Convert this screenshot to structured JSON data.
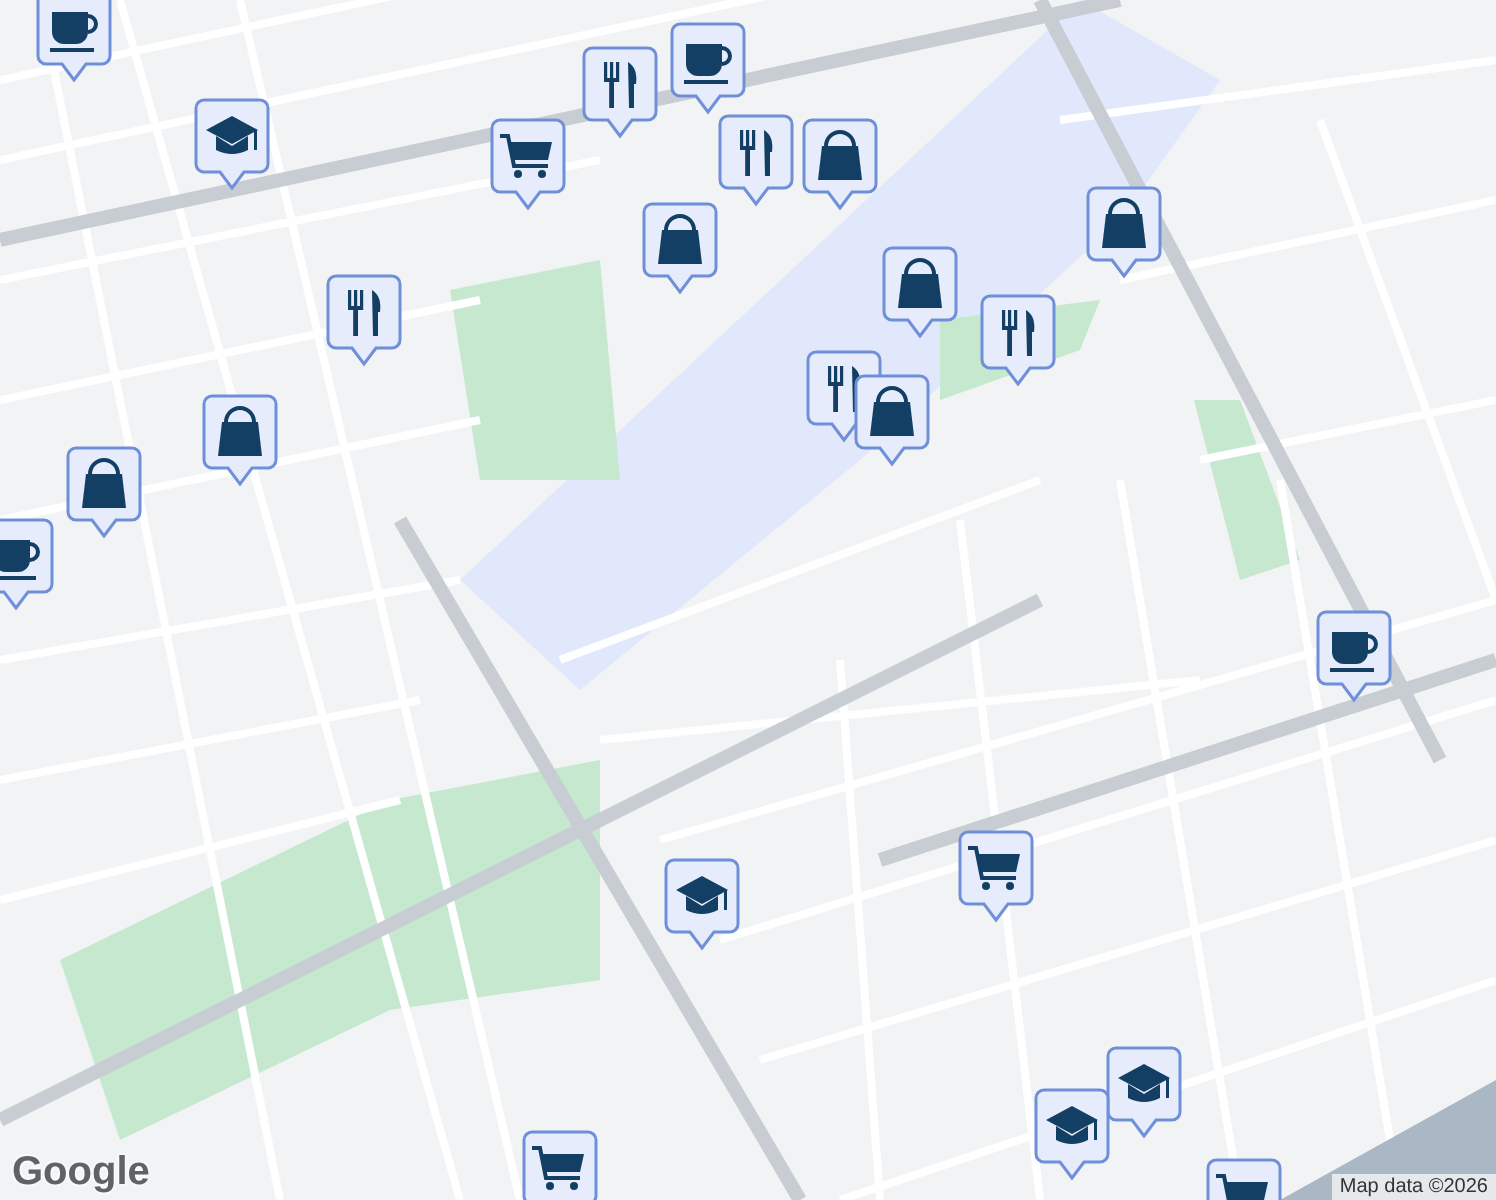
{
  "map": {
    "markers": [
      {
        "kind": "cafe"
      },
      {
        "kind": "school"
      },
      {
        "kind": "restaurant"
      },
      {
        "kind": "cafe"
      },
      {
        "kind": "cart"
      },
      {
        "kind": "restaurant"
      },
      {
        "kind": "bag"
      },
      {
        "kind": "bag"
      },
      {
        "kind": "bag"
      },
      {
        "kind": "restaurant"
      },
      {
        "kind": "bag"
      },
      {
        "kind": "restaurant"
      },
      {
        "kind": "restaurant"
      },
      {
        "kind": "bag"
      },
      {
        "kind": "bag"
      },
      {
        "kind": "bag"
      },
      {
        "kind": "cafe"
      },
      {
        "kind": "cafe"
      },
      {
        "kind": "cart"
      },
      {
        "kind": "school"
      },
      {
        "kind": "school"
      },
      {
        "kind": "school"
      },
      {
        "kind": "cart"
      },
      {
        "kind": "cart"
      }
    ],
    "logo": "Google",
    "attribution": "Map data ©2026"
  }
}
